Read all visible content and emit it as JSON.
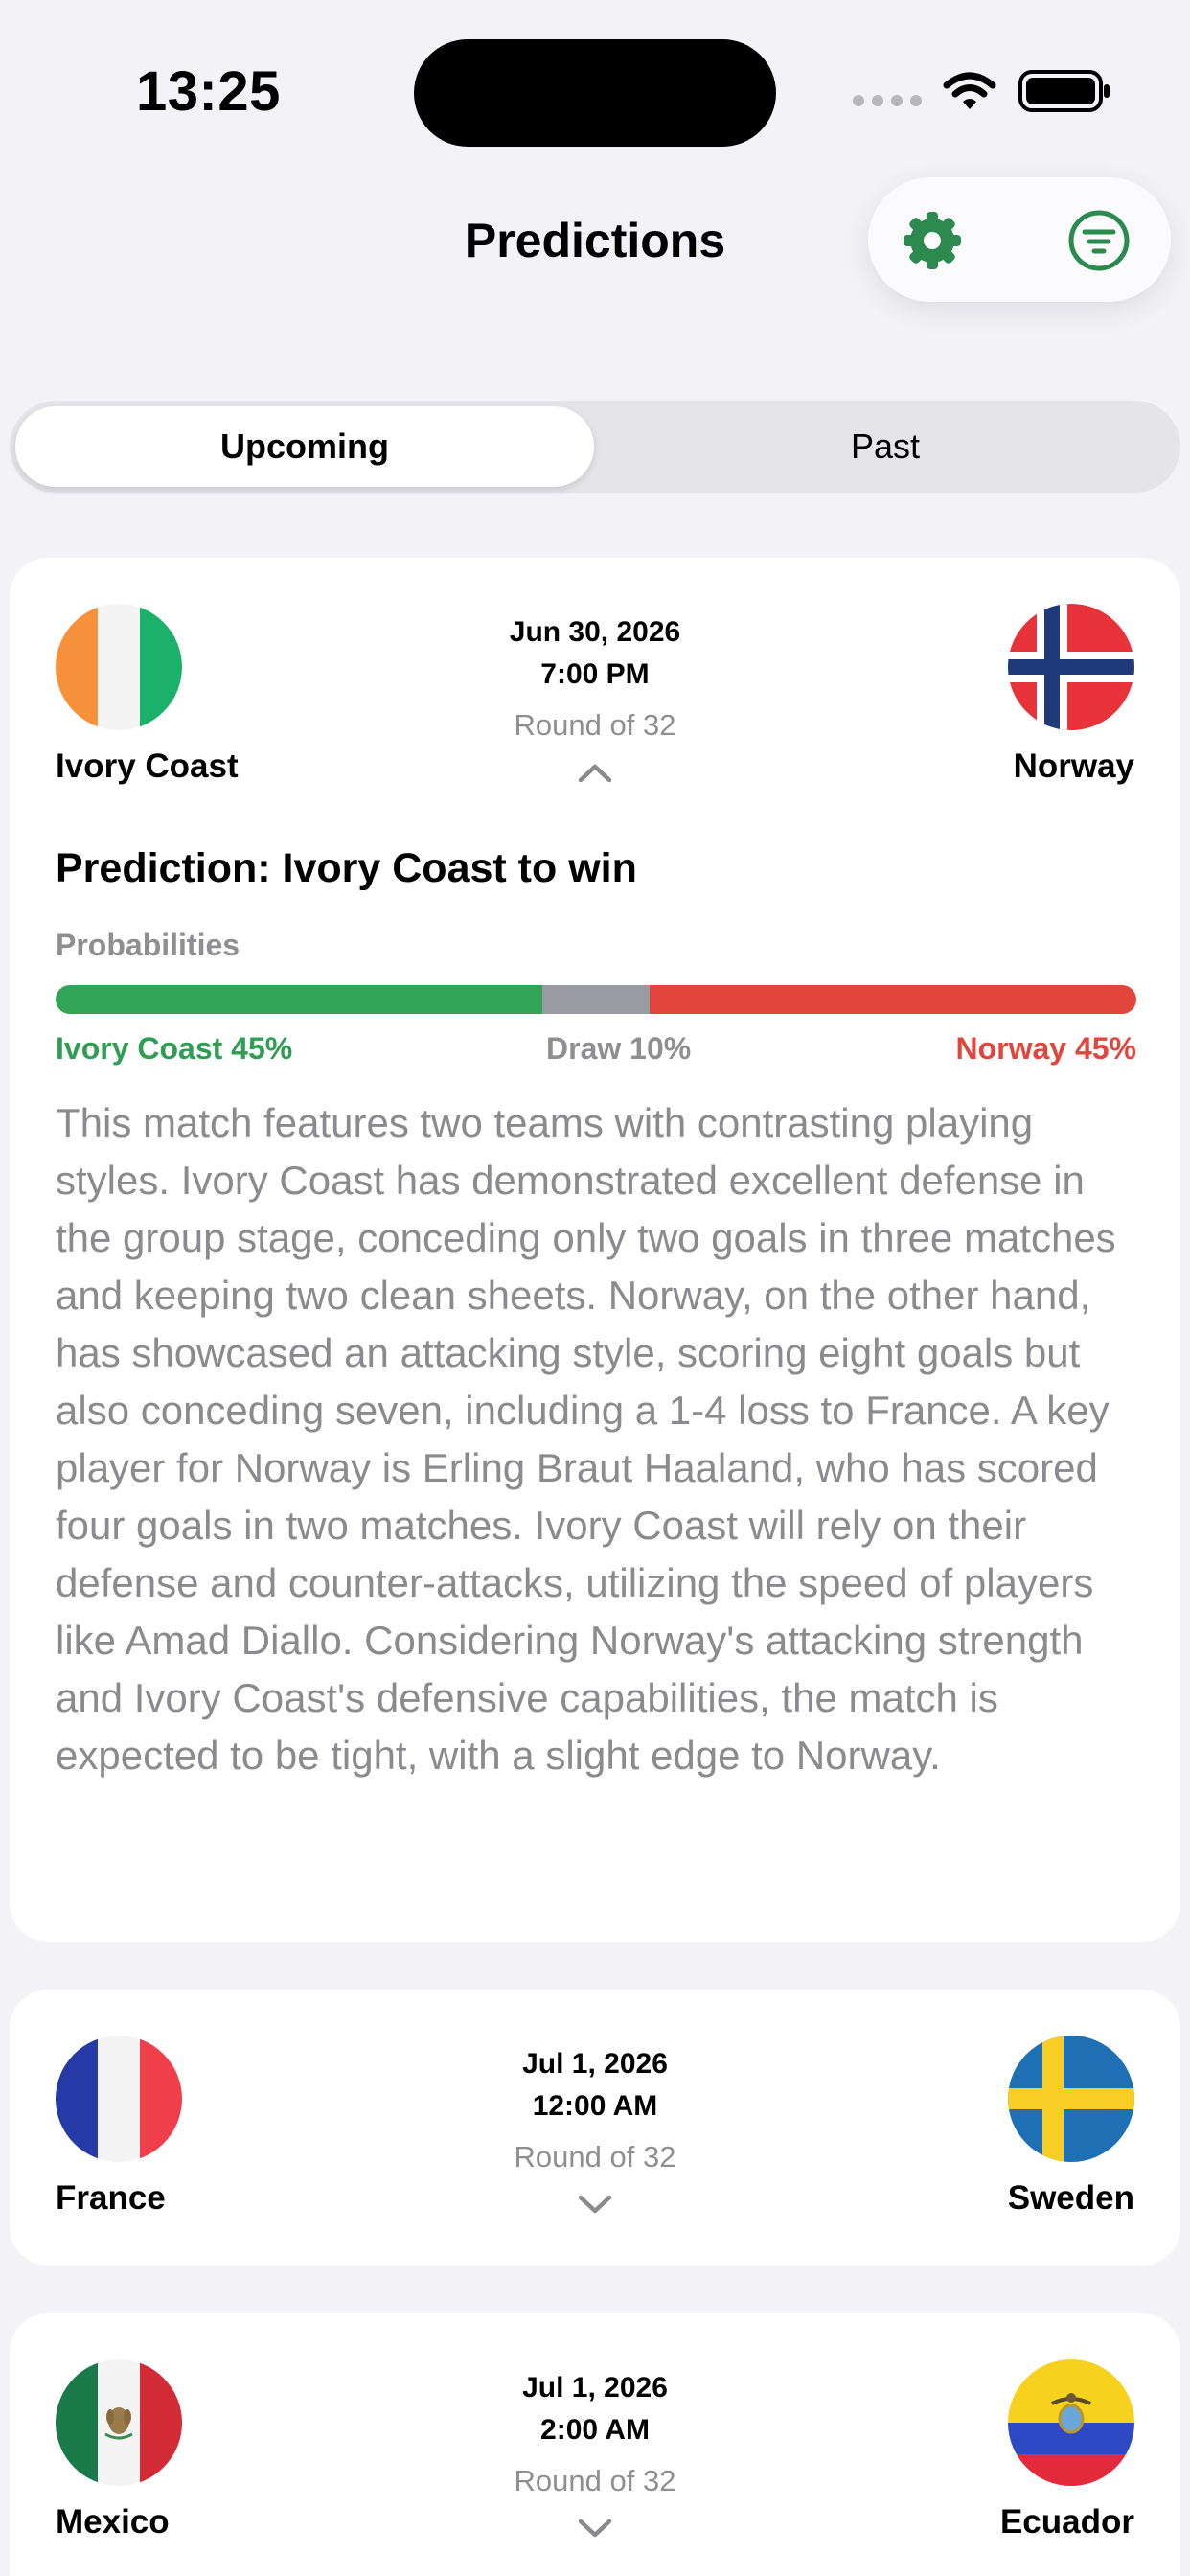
{
  "status_bar": {
    "time": "13:25",
    "icons": [
      "signal-dots-icon",
      "wifi-icon",
      "battery-icon"
    ]
  },
  "header": {
    "title": "Predictions",
    "toolbar_icons": [
      "gear-icon",
      "filter-icon"
    ],
    "accent_color": "#2c8a4e"
  },
  "segmented": {
    "options": [
      {
        "label": "Upcoming",
        "selected": true
      },
      {
        "label": "Past",
        "selected": false
      }
    ]
  },
  "matches": [
    {
      "home": {
        "name": "Ivory Coast",
        "flag": "ivory-coast-flag"
      },
      "away": {
        "name": "Norway",
        "flag": "norway-flag"
      },
      "date": "Jun 30, 2026",
      "time": "7:00 PM",
      "round": "Round of 32",
      "expanded": true,
      "prediction_title": "Prediction: Ivory Coast to win",
      "probabilities_label": "Probabilities",
      "probabilities": {
        "home": 45,
        "draw": 10,
        "away": 45
      },
      "probability_texts": {
        "home": "Ivory Coast 45%",
        "draw": "Draw 10%",
        "away": "Norway 45%"
      },
      "colors": {
        "home": "#33a357",
        "draw": "#9a9ba1",
        "away": "#e0463c"
      },
      "analysis": "This match features two teams with contrasting playing styles. Ivory Coast has demonstrated excellent defense in the group stage, conceding only two goals in three matches and keeping two clean sheets. Norway, on the other hand, has showcased an attacking style, scoring eight goals but also conceding seven, including a 1-4 loss to France. A key player for Norway is Erling Braut Haaland, who has scored four goals in two matches. Ivory Coast will rely on their defense and counter-attacks, utilizing the speed of players like Amad Diallo. Considering Norway's attacking strength and Ivory Coast's defensive capabilities, the match is expected to be tight, with a slight edge to Norway."
    },
    {
      "home": {
        "name": "France",
        "flag": "france-flag"
      },
      "away": {
        "name": "Sweden",
        "flag": "sweden-flag"
      },
      "date": "Jul 1, 2026",
      "time": "12:00 AM",
      "round": "Round of 32",
      "expanded": false
    },
    {
      "home": {
        "name": "Mexico",
        "flag": "mexico-flag"
      },
      "away": {
        "name": "Ecuador",
        "flag": "ecuador-flag"
      },
      "date": "Jul 1, 2026",
      "time": "2:00 AM",
      "round": "Round of 32",
      "expanded": false
    }
  ]
}
